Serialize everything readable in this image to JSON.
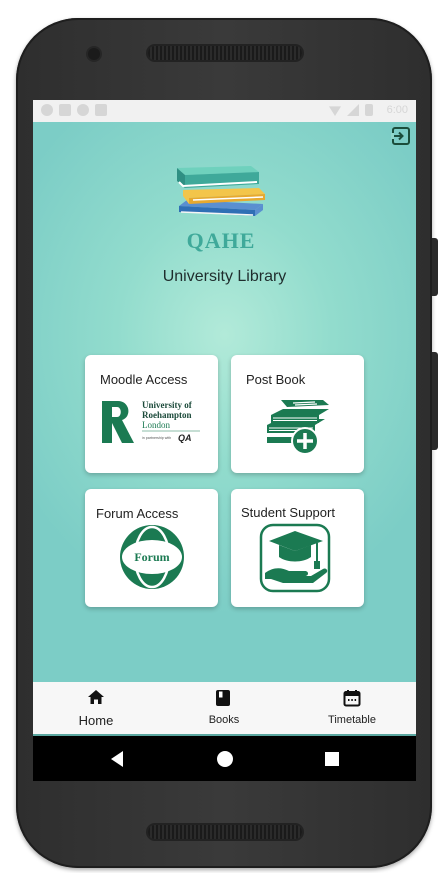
{
  "device": {
    "status_bar": {
      "time": "6:00"
    }
  },
  "header": {
    "logout_icon": "exit-icon",
    "logo_text": "QAHE",
    "title": "University Library"
  },
  "cards": [
    {
      "label": "Moodle Access",
      "image_text": {
        "line1": "University of",
        "line2": "Roehampton",
        "line3": "London",
        "partner": "in partnership with",
        "partner_mark": "QA"
      }
    },
    {
      "label": "Post Book",
      "icon": "add-book-icon"
    },
    {
      "label": "Forum Access",
      "image_text": {
        "word": "Forum"
      }
    },
    {
      "label": "Student Support",
      "icon": "graduation-cap-hand-icon"
    }
  ],
  "bottom_nav": [
    {
      "label": "Home",
      "icon": "home-icon",
      "active": true
    },
    {
      "label": "Books",
      "icon": "book-icon",
      "active": false
    },
    {
      "label": "Timetable",
      "icon": "calendar-icon",
      "active": false
    }
  ],
  "system_nav": {
    "back_icon": "back-triangle-icon",
    "home_icon": "home-circle-icon",
    "recents_icon": "recents-square-icon"
  },
  "colors": {
    "accent": "#1b7a52",
    "background_teal": "#8fd8ca",
    "logo_teal": "#3fa99a"
  }
}
